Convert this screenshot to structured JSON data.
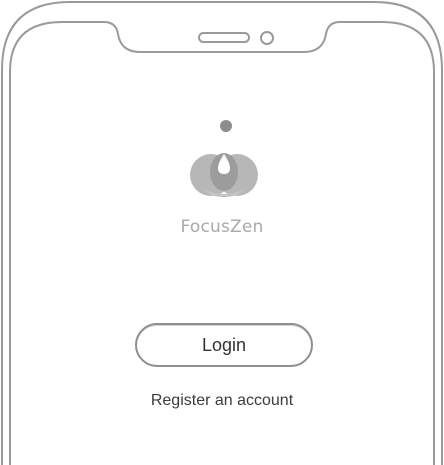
{
  "app": {
    "name": "FocusZen",
    "logo_icon": "lotus-drop-icon"
  },
  "actions": {
    "login_label": "Login",
    "register_label": "Register an account"
  },
  "colors": {
    "device_frame": "#9a9a9a",
    "logo_gray": "#b3b3b3",
    "logo_dark": "#8c8c8c",
    "text_muted": "#a9a9a9",
    "text_dark": "#333333"
  }
}
